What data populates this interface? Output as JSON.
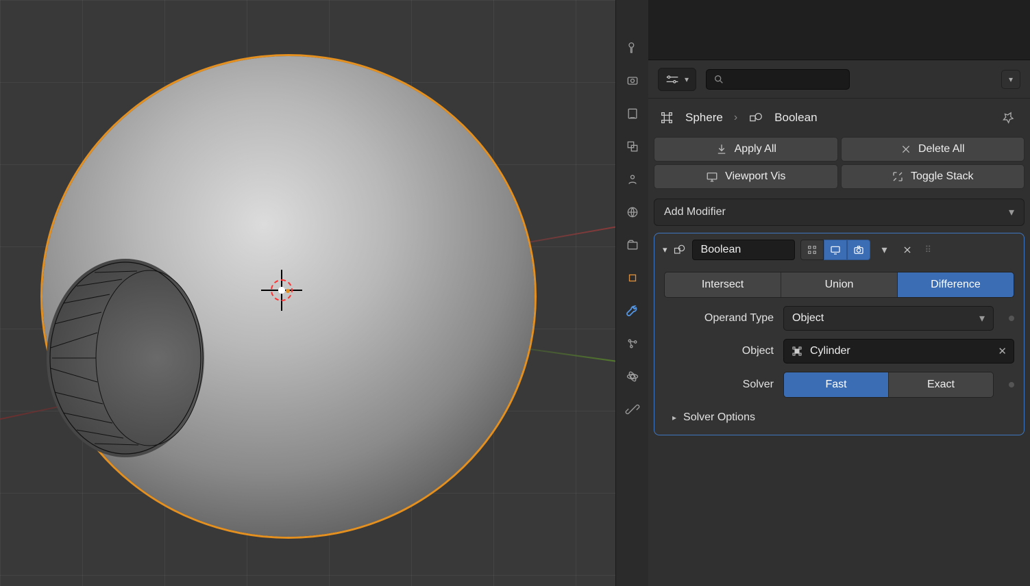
{
  "breadcrumb": {
    "object": "Sphere",
    "modifier": "Boolean"
  },
  "search": {
    "placeholder": ""
  },
  "quick_buttons": {
    "apply_all": "Apply All",
    "delete_all": "Delete All",
    "viewport_vis": "Viewport Vis",
    "toggle_stack": "Toggle Stack"
  },
  "add_modifier": {
    "label": "Add Modifier"
  },
  "modifier": {
    "name": "Boolean",
    "toggles": {
      "edit_mode": false,
      "realtime": true,
      "render": true
    },
    "operation": {
      "options": [
        "Intersect",
        "Union",
        "Difference"
      ],
      "selected": "Difference"
    },
    "operand_type": {
      "label": "Operand Type",
      "value": "Object"
    },
    "object_field": {
      "label": "Object",
      "value": "Cylinder"
    },
    "solver": {
      "label": "Solver",
      "options": [
        "Fast",
        "Exact"
      ],
      "selected": "Fast"
    },
    "solver_options": {
      "label": "Solver Options"
    }
  },
  "icons": {
    "search": "search-icon",
    "options": "options-icon",
    "pin": "pin-icon",
    "download": "download-icon",
    "close": "close-icon",
    "monitor": "monitor-icon",
    "expand": "expand-icon",
    "chevron_down": "chevron-down-icon",
    "modifier": "modifier-icon",
    "object": "object-icon",
    "grip": "grip-icon",
    "camera": "camera-icon",
    "edit": "edit-icon",
    "wrench": "wrench-icon"
  },
  "property_tabs": [
    "tool-icon",
    "render-icon",
    "output-icon",
    "viewlayer-icon",
    "scene-icon",
    "world-icon",
    "collection-icon",
    "object-icon",
    "wrench-icon",
    "particles-icon",
    "physics-icon",
    "constraints-icon"
  ]
}
